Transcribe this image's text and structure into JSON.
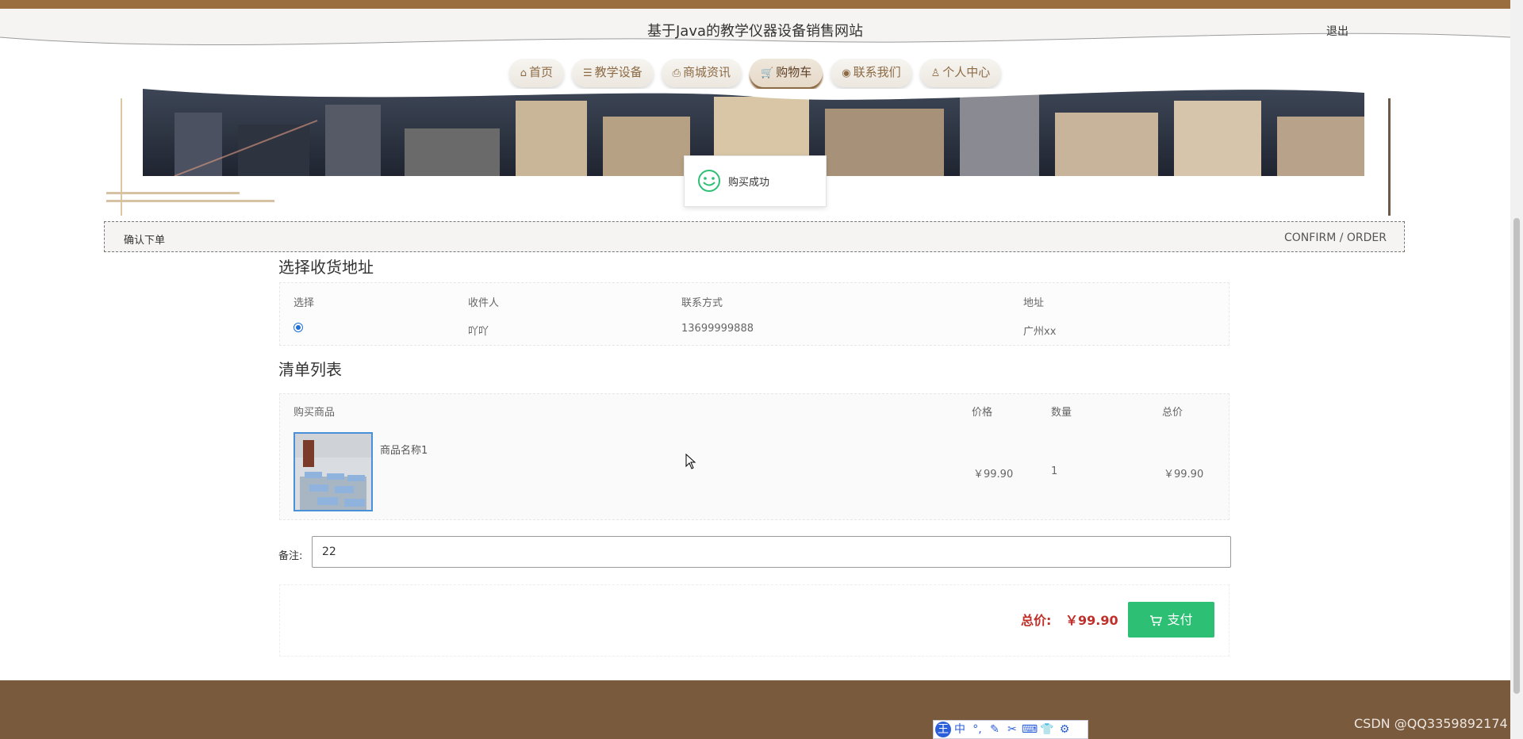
{
  "header": {
    "site_title": "基于Java的教学仪器设备销售网站",
    "logout": "退出"
  },
  "nav": [
    {
      "label": "首页",
      "icon": "home-icon",
      "active": false
    },
    {
      "label": "教学设备",
      "icon": "layers-icon",
      "active": false
    },
    {
      "label": "商城资讯",
      "icon": "printer-icon",
      "active": false
    },
    {
      "label": "购物车",
      "icon": "cart-icon",
      "active": true
    },
    {
      "label": "联系我们",
      "icon": "chat-icon",
      "active": false
    },
    {
      "label": "个人中心",
      "icon": "user-icon",
      "active": false
    }
  ],
  "toast": {
    "message": "购买成功"
  },
  "section": {
    "title_cn": "确认下单",
    "title_en": "CONFIRM / ORDER"
  },
  "address": {
    "heading": "选择收货地址",
    "columns": [
      "选择",
      "收件人",
      "联系方式",
      "地址"
    ],
    "rows": [
      {
        "selected": true,
        "recipient": "吖吖",
        "phone": "13699999888",
        "address": "广州xx"
      }
    ]
  },
  "items": {
    "heading": "清单列表",
    "columns": {
      "product": "购买商品",
      "price": "价格",
      "qty": "数量",
      "total": "总价"
    },
    "rows": [
      {
        "name": "商品名称1",
        "price": "￥99.90",
        "qty": "1",
        "total": "￥99.90"
      }
    ]
  },
  "remark": {
    "label": "备注:",
    "value": "22"
  },
  "summary": {
    "total_label": "总价:",
    "total_value": "￥99.90",
    "pay_label": "支付"
  },
  "taskbar": {
    "ime_items": [
      "王",
      "中",
      "°,",
      "✎",
      "✂",
      "⌨",
      "👕",
      "⚙"
    ]
  },
  "watermark": "CSDN @QQ3359892174",
  "colors": {
    "brand_brown": "#9a6e3e",
    "footer_brown": "#7a5a3c",
    "pay_green": "#2dbf73",
    "price_red": "#c0302b"
  }
}
